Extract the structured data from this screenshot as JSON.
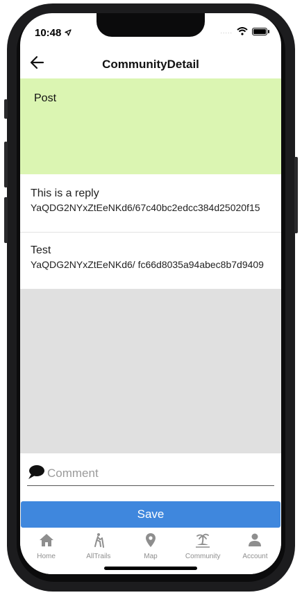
{
  "status_bar": {
    "time": "10:48",
    "signal": "....."
  },
  "nav": {
    "title": "CommunityDetail"
  },
  "post": {
    "text": "Post",
    "background": "#dbf5b2"
  },
  "replies": [
    {
      "title": "This is a reply",
      "id": "YaQDG2NYxZtEeNKd6/67c40bc2edcc384d25020f15"
    },
    {
      "title": "Test",
      "id": "YaQDG2NYxZtEeNKd6/ fc66d8035a94abec8b7d9409"
    }
  ],
  "comment": {
    "placeholder": "Comment",
    "value": ""
  },
  "save_label": "Save",
  "tabs": [
    {
      "label": "Home",
      "icon": "home-icon"
    },
    {
      "label": "AllTrails",
      "icon": "hiker-icon"
    },
    {
      "label": "Map",
      "icon": "map-pin-icon"
    },
    {
      "label": "Community",
      "icon": "island-icon"
    },
    {
      "label": "Account",
      "icon": "person-icon"
    }
  ],
  "colors": {
    "accent": "#3f87dd",
    "tab_inactive": "#8e8e8e",
    "empty_area": "#e0e0e0"
  }
}
